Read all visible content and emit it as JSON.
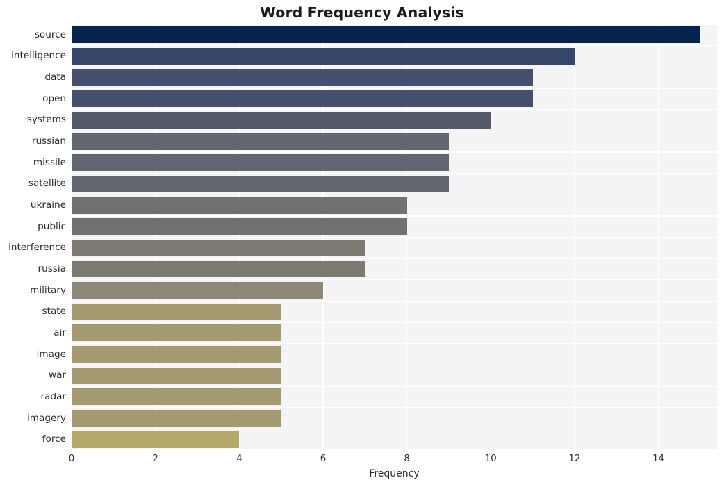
{
  "chart_data": {
    "type": "bar",
    "orientation": "horizontal",
    "title": "Word Frequency Analysis",
    "xlabel": "Frequency",
    "ylabel": "",
    "xlim": [
      0,
      15.4
    ],
    "ylim_categories": 20,
    "grid": true,
    "legend": "none",
    "xticks": [
      0,
      2,
      4,
      6,
      8,
      10,
      12,
      14
    ],
    "xtick_labels": [
      "0",
      "2",
      "4",
      "6",
      "8",
      "10",
      "12",
      "14"
    ],
    "categories": [
      "source",
      "intelligence",
      "data",
      "open",
      "systems",
      "russian",
      "missile",
      "satellite",
      "ukraine",
      "public",
      "interference",
      "russia",
      "military",
      "state",
      "air",
      "image",
      "war",
      "radar",
      "imagery",
      "force"
    ],
    "values": [
      15,
      12,
      11,
      11,
      10,
      9,
      9,
      9,
      8,
      8,
      7,
      7,
      6,
      5,
      5,
      5,
      5,
      5,
      5,
      4
    ],
    "bar_colors": [
      "#04244e",
      "#36456a",
      "#454f6e",
      "#454f6e",
      "#535867",
      "#636670",
      "#636670",
      "#636670",
      "#717171",
      "#717171",
      "#7c7b73",
      "#7c7b73",
      "#8b8878",
      "#a39a72",
      "#a39a72",
      "#a39a72",
      "#a39a72",
      "#a39a72",
      "#a39a72",
      "#b5a868"
    ],
    "plot_background": "#f4f4f5",
    "gridline_color": "#ffffff",
    "figure_background": "#ffffff",
    "text_color": "#2b2b2b"
  }
}
